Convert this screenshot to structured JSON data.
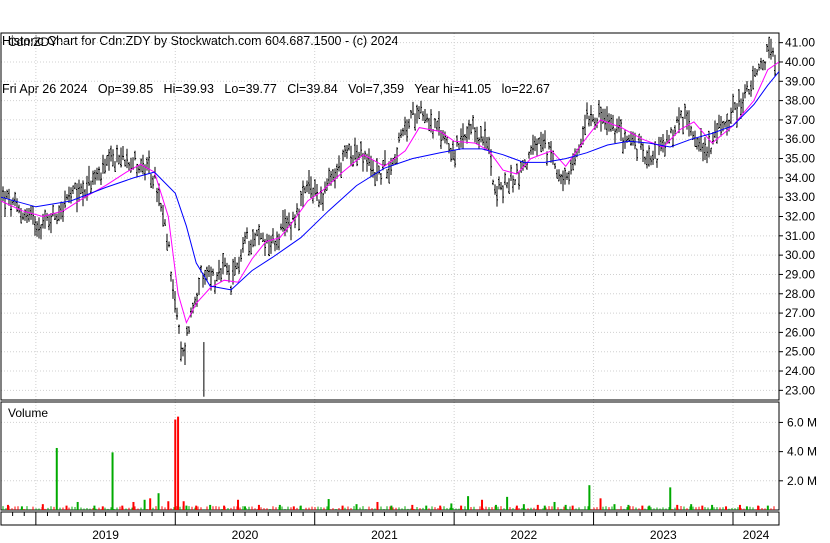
{
  "header": {
    "title": "Historic Chart for Cdn:ZDY by Stockwatch.com 604.687.1500 - (c) 2024",
    "quote": "Fri Apr 26 2024   Op=39.85   Hi=39.93   Lo=39.77   Cl=39.84   Vol=7,359   Year hi=41.05   lo=22.67"
  },
  "colors": {
    "price_bars": "#000000",
    "ma_short": "#ff00ff",
    "ma_long": "#0000ff",
    "volume_up": "#00aa00",
    "volume_down": "#ff0000",
    "grid": "#d0d0d0"
  },
  "chart_data": [
    {
      "type": "line",
      "title": "Cdn:ZDY",
      "xlabel": "",
      "ylabel": "",
      "x_axis_labels": [
        "2019",
        "2020",
        "2021",
        "2022",
        "2023",
        "2024"
      ],
      "x_range": [
        2018.75,
        2024.33
      ],
      "ylim": [
        22.5,
        41.5
      ],
      "y_ticks": [
        23,
        24,
        25,
        26,
        27,
        28,
        29,
        30,
        31,
        32,
        33,
        34,
        35,
        36,
        37,
        38,
        39,
        40,
        41
      ],
      "y_tick_labels": [
        "23.00",
        "24.00",
        "25.00",
        "26.00",
        "27.00",
        "28.00",
        "29.00",
        "30.00",
        "31.00",
        "32.00",
        "33.00",
        "34.00",
        "35.00",
        "36.00",
        "37.00",
        "38.00",
        "39.00",
        "40.00",
        "41.00"
      ],
      "grid": true,
      "series": [
        {
          "role": "price",
          "x": [
            2018.75,
            2018.85,
            2018.95,
            2019.05,
            2019.15,
            2019.25,
            2019.35,
            2019.45,
            2019.55,
            2019.65,
            2019.75,
            2019.85,
            2019.95,
            2020.05,
            2020.1,
            2020.15,
            2020.18,
            2020.2,
            2020.22,
            2020.25,
            2020.3,
            2020.35,
            2020.4,
            2020.5,
            2020.6,
            2020.7,
            2020.8,
            2020.9,
            2020.95,
            2021.05,
            2021.15,
            2021.25,
            2021.35,
            2021.45,
            2021.55,
            2021.65,
            2021.75,
            2021.85,
            2021.95,
            2022.0,
            2022.05,
            2022.15,
            2022.25,
            2022.3,
            2022.4,
            2022.5,
            2022.6,
            2022.7,
            2022.8,
            2022.9,
            2022.95,
            2023.05,
            2023.15,
            2023.25,
            2023.35,
            2023.45,
            2023.55,
            2023.62,
            2023.7,
            2023.8,
            2023.9,
            2024.0,
            2024.1,
            2024.2,
            2024.25,
            2024.3,
            2024.33
          ],
          "y": [
            33.2,
            32.4,
            32.0,
            31.6,
            32.2,
            33.0,
            33.5,
            34.1,
            34.8,
            35.2,
            34.6,
            34.0,
            30.5,
            24.5,
            26.5,
            28.0,
            29.0,
            28.3,
            28.9,
            29.2,
            28.5,
            29.4,
            28.4,
            30.8,
            31.0,
            30.6,
            31.5,
            32.5,
            33.5,
            33.0,
            34.2,
            35.5,
            35.0,
            34.2,
            34.8,
            36.5,
            37.8,
            36.6,
            36.0,
            35.2,
            35.8,
            36.4,
            35.6,
            33.2,
            33.8,
            34.6,
            35.8,
            35.2,
            33.5,
            35.5,
            37.4,
            37.2,
            36.5,
            36.0,
            35.4,
            35.2,
            36.0,
            37.2,
            36.7,
            35.3,
            36.5,
            37.4,
            38.4,
            39.6,
            40.6,
            40.3,
            39.8
          ]
        },
        {
          "role": "ma_short",
          "x": [
            2018.75,
            2018.9,
            2019.05,
            2019.2,
            2019.35,
            2019.5,
            2019.65,
            2019.75,
            2019.85,
            2019.95,
            2020.02,
            2020.08,
            2020.15,
            2020.25,
            2020.35,
            2020.45,
            2020.55,
            2020.65,
            2020.75,
            2020.85,
            2020.95,
            2021.05,
            2021.2,
            2021.35,
            2021.5,
            2021.65,
            2021.75,
            2021.9,
            2022.0,
            2022.15,
            2022.25,
            2022.35,
            2022.45,
            2022.55,
            2022.7,
            2022.8,
            2022.92,
            2023.05,
            2023.2,
            2023.35,
            2023.5,
            2023.62,
            2023.72,
            2023.85,
            2024.0,
            2024.15,
            2024.25,
            2024.33
          ],
          "y": [
            32.8,
            32.3,
            32.0,
            32.3,
            33.0,
            33.6,
            34.3,
            34.7,
            34.3,
            32.0,
            28.0,
            26.5,
            27.5,
            28.3,
            28.7,
            28.6,
            29.8,
            30.7,
            30.9,
            31.8,
            32.8,
            33.3,
            34.3,
            35.2,
            34.6,
            35.4,
            36.6,
            36.4,
            35.9,
            35.8,
            35.4,
            34.4,
            34.2,
            35.0,
            35.4,
            34.6,
            35.8,
            37.0,
            36.6,
            36.0,
            35.6,
            36.5,
            36.9,
            35.8,
            36.7,
            38.0,
            39.6,
            40.0
          ]
        },
        {
          "role": "ma_long",
          "x": [
            2018.75,
            2019.0,
            2019.25,
            2019.5,
            2019.7,
            2019.85,
            2020.0,
            2020.08,
            2020.15,
            2020.25,
            2020.4,
            2020.55,
            2020.7,
            2020.9,
            2021.1,
            2021.3,
            2021.5,
            2021.7,
            2021.9,
            2022.05,
            2022.2,
            2022.35,
            2022.5,
            2022.65,
            2022.8,
            2022.95,
            2023.1,
            2023.25,
            2023.4,
            2023.55,
            2023.7,
            2023.85,
            2024.0,
            2024.15,
            2024.25,
            2024.33
          ],
          "y": [
            33.0,
            32.5,
            32.8,
            33.5,
            34.0,
            34.3,
            33.2,
            31.5,
            29.6,
            28.4,
            28.2,
            29.2,
            29.9,
            30.9,
            32.3,
            33.6,
            34.5,
            35.0,
            35.3,
            35.5,
            35.5,
            35.2,
            34.8,
            34.8,
            35.0,
            35.3,
            35.7,
            35.9,
            35.8,
            35.6,
            36.0,
            36.3,
            36.7,
            37.8,
            38.8,
            39.5
          ]
        }
      ]
    },
    {
      "type": "bar",
      "title": "Volume",
      "xlabel": "",
      "ylabel": "",
      "x_range": [
        2018.75,
        2024.33
      ],
      "ylim": [
        0,
        7.4
      ],
      "y_ticks": [
        2,
        4,
        6
      ],
      "y_tick_labels": [
        "2.0 M",
        "4.0 M",
        "6.0 M"
      ],
      "unit": "M",
      "grid": true,
      "series": [
        {
          "name": "up",
          "x": [
            2018.9,
            2019.15,
            2019.3,
            2019.42,
            2019.55,
            2019.78,
            2019.88,
            2020.08,
            2020.25,
            2020.5,
            2020.75,
            2020.9,
            2021.1,
            2021.3,
            2021.55,
            2021.8,
            2021.98,
            2022.1,
            2022.3,
            2022.38,
            2022.5,
            2022.65,
            2022.72,
            2022.8,
            2022.97,
            2023.15,
            2023.25,
            2023.4,
            2023.55,
            2023.7,
            2023.85,
            2024.1,
            2024.25
          ],
          "values": [
            0.25,
            4.25,
            0.55,
            0.3,
            3.95,
            0.7,
            1.15,
            0.3,
            0.35,
            0.25,
            0.35,
            0.3,
            0.75,
            0.4,
            0.3,
            0.3,
            0.45,
            0.95,
            0.35,
            0.9,
            0.4,
            0.3,
            0.55,
            0.35,
            1.7,
            0.4,
            0.35,
            0.3,
            1.55,
            0.4,
            0.35,
            0.25,
            0.3
          ]
        },
        {
          "name": "down",
          "x": [
            2018.8,
            2019.05,
            2019.22,
            2019.48,
            2019.62,
            2019.7,
            2019.82,
            2019.95,
            2020.0,
            2020.02,
            2020.06,
            2020.15,
            2020.35,
            2020.45,
            2020.6,
            2020.85,
            2021.2,
            2021.45,
            2021.7,
            2021.9,
            2022.05,
            2022.2,
            2022.45,
            2022.6,
            2022.85,
            2023.05,
            2023.35,
            2023.6,
            2023.78,
            2023.95,
            2024.05,
            2024.18
          ],
          "values": [
            0.35,
            0.4,
            0.3,
            0.25,
            0.3,
            0.55,
            0.8,
            0.6,
            6.2,
            6.4,
            0.6,
            0.3,
            0.3,
            0.7,
            0.35,
            0.25,
            0.3,
            0.55,
            0.35,
            0.3,
            0.3,
            0.7,
            0.3,
            0.35,
            0.3,
            0.8,
            0.3,
            0.35,
            0.3,
            0.25,
            0.35,
            0.3
          ]
        }
      ]
    }
  ]
}
